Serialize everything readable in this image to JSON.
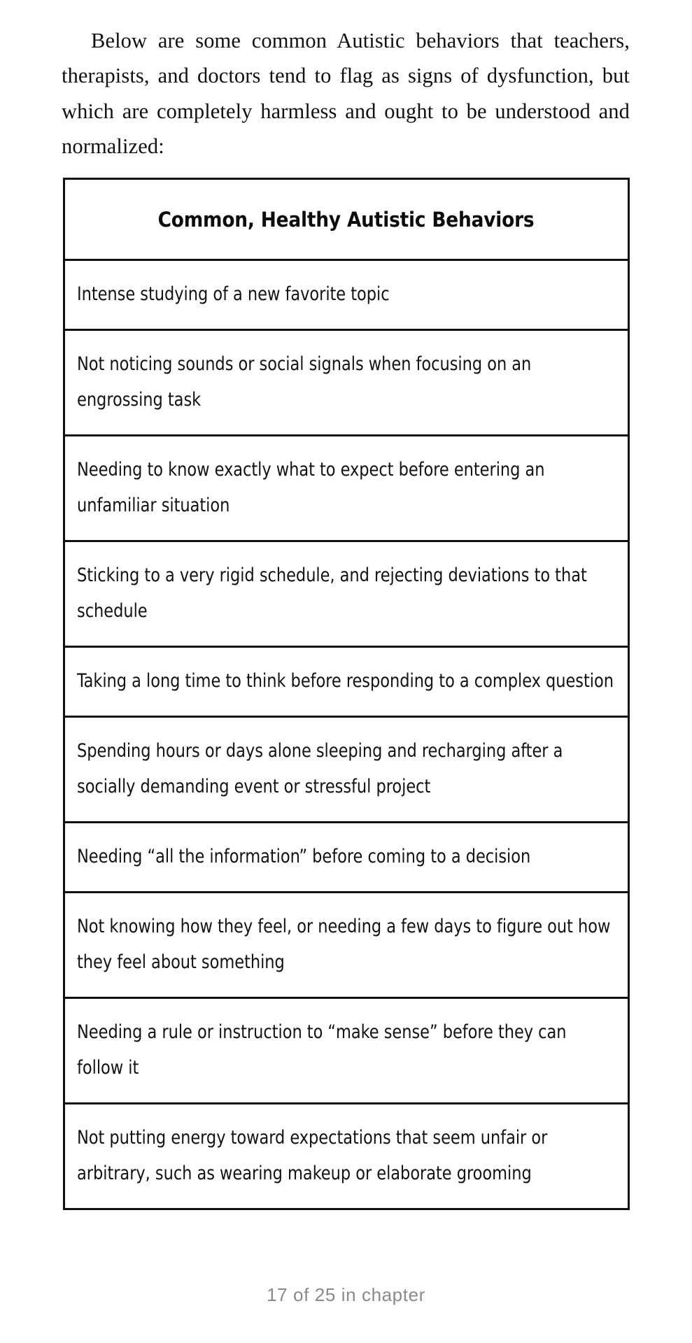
{
  "page": {
    "intro_paragraph": "Below are some common Autistic behaviors that teachers, therapists, and doctors tend to flag as signs of dysfunction, but which are completely harmless and ought to be understood and normalized:",
    "footer_status": "17 of 25 in chapter"
  },
  "table": {
    "header": "Common, Healthy Autistic Behaviors",
    "rows": [
      "Intense studying of a new favorite topic",
      "Not noticing sounds or social signals when focusing on an engrossing task",
      "Needing to know exactly what to expect before entering an unfamiliar situation",
      "Sticking to a very rigid schedule, and rejecting deviations to that schedule",
      "Taking a long time to think before responding to a complex question",
      "Spending hours or days alone sleeping and recharging after a socially demanding event or stressful project",
      "Needing “all the information” before coming to a decision",
      "Not knowing how they feel, or needing a few days to figure out how they feel about something",
      "Needing a rule or instruction to “make sense” before they can follow it",
      "Not putting energy toward expectations that seem unfair or arbitrary, such as wearing makeup or elaborate grooming"
    ]
  },
  "colors": {
    "page_background": "#ffffff",
    "body_text": "#111111",
    "table_border": "#111111",
    "footer_text": "#8a8a8a"
  }
}
